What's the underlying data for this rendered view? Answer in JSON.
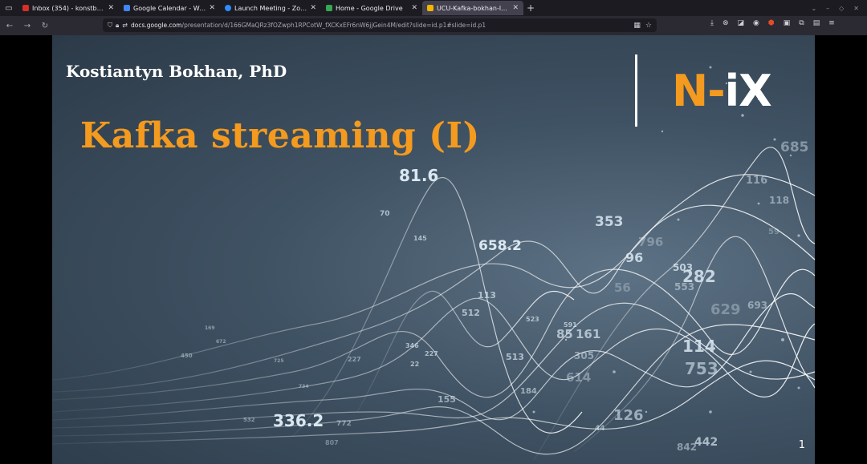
{
  "browser": {
    "tabs": [
      {
        "label": "Inbox (354) - konstboh@gr",
        "color": "#d93025",
        "active": false
      },
      {
        "label": "Google Calendar - Week of",
        "color": "#4285f4",
        "active": false
      },
      {
        "label": "Launch Meeting - Zoom",
        "color": "#2d8cff",
        "active": false
      },
      {
        "label": "Home - Google Drive",
        "color": "#34a853",
        "active": false
      },
      {
        "label": "UCU-Kafka-bokhan-lesson-",
        "color": "#f4b400",
        "active": true
      }
    ],
    "url_host": "docs.google.com",
    "url_path": "/presentation/d/166GMaQRz3fOZwph1RPCotW_fXCKxEFr6nW6jjGein4M/edit?slide=id.p1#slide=id.p1"
  },
  "slide": {
    "author": "Kostiantyn Bokhan, PhD",
    "title": "Kafka streaming (I)",
    "logo_part1": "N-",
    "logo_part2": "iX",
    "page_number": "1",
    "accent_color": "#f39a1f"
  },
  "background_numbers": [
    "81.6",
    "658.2",
    "353",
    "96",
    "282",
    "114",
    "753",
    "336.2",
    "126",
    "685",
    "116",
    "118",
    "503",
    "553",
    "693",
    "513",
    "614",
    "305",
    "85",
    "161",
    "591",
    "523",
    "512",
    "113",
    "145",
    "70",
    "346",
    "227",
    "22",
    "155",
    "184",
    "44",
    "442",
    "842",
    "772",
    "807",
    "532",
    "450",
    "672",
    "169",
    "725",
    "734",
    "227",
    "796",
    "629",
    "56",
    "59"
  ]
}
